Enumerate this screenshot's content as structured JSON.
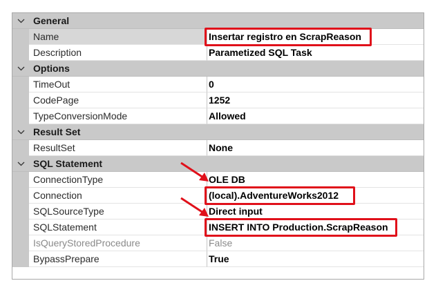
{
  "categories": [
    {
      "label": "General"
    },
    {
      "label": "Options"
    },
    {
      "label": "Result Set"
    },
    {
      "label": "SQL Statement"
    }
  ],
  "properties": {
    "name": {
      "name": "Name",
      "value": "Insertar registro en ScrapReason"
    },
    "description": {
      "name": "Description",
      "value": "Parametized SQL Task"
    },
    "timeout": {
      "name": "TimeOut",
      "value": "0"
    },
    "codepage": {
      "name": "CodePage",
      "value": "1252"
    },
    "typeconversion": {
      "name": "TypeConversionMode",
      "value": "Allowed"
    },
    "resultset": {
      "name": "ResultSet",
      "value": "None"
    },
    "connectiontype": {
      "name": "ConnectionType",
      "value": "OLE DB"
    },
    "connection": {
      "name": "Connection",
      "value": "(local).AdventureWorks2012"
    },
    "sqlsourcetype": {
      "name": "SQLSourceType",
      "value": "Direct input"
    },
    "sqlstatement": {
      "name": "SQLStatement",
      "value": "INSERT INTO Production.ScrapReason"
    },
    "isquerystored": {
      "name": "IsQueryStoredProcedure",
      "value": "False"
    },
    "bypassprepare": {
      "name": "BypassPrepare",
      "value": "True"
    }
  },
  "colors": {
    "category_bg": "#c9c9c9",
    "highlight": "#e0101a",
    "readonly_text": "#8a8a8a"
  },
  "icons": {
    "category_toggle": "chevron-down-icon",
    "annotation": "red-arrow-icon"
  }
}
